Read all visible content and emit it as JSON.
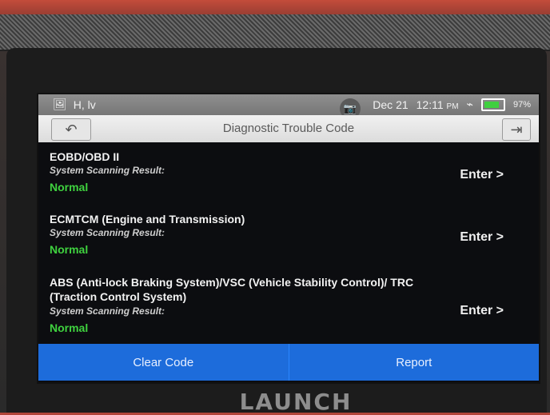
{
  "statusbar": {
    "left_icons": [
      "image-icon",
      "signal-icon"
    ],
    "left_text": "H, lv",
    "camera_label": "camera-icon",
    "date": "Dec 21",
    "time": "12:11",
    "ampm": "PM",
    "battery": "97%"
  },
  "titlebar": {
    "title": "Diagnostic Trouble Code",
    "back_icon": "back-arrow-icon",
    "exit_icon": "exit-icon"
  },
  "systems": [
    {
      "name": "EOBD/OBD II",
      "result_label": "System Scanning Result:",
      "status": "Normal",
      "enter_label": "Enter >"
    },
    {
      "name": "ECMTCM (Engine and Transmission)",
      "result_label": "System Scanning Result:",
      "status": "Normal",
      "enter_label": "Enter >"
    },
    {
      "name": "ABS (Anti-lock Braking System)/VSC (Vehicle Stability Control)/ TRC (Traction Control System)",
      "result_label": "System Scanning Result:",
      "status": "Normal",
      "enter_label": "Enter >"
    }
  ],
  "bottombar": {
    "clear_label": "Clear Code",
    "report_label": "Report"
  },
  "brand": {
    "logo_text": "LAUNCH"
  },
  "colors": {
    "accent": "#1d6cdb",
    "normal": "#3fd23f"
  }
}
